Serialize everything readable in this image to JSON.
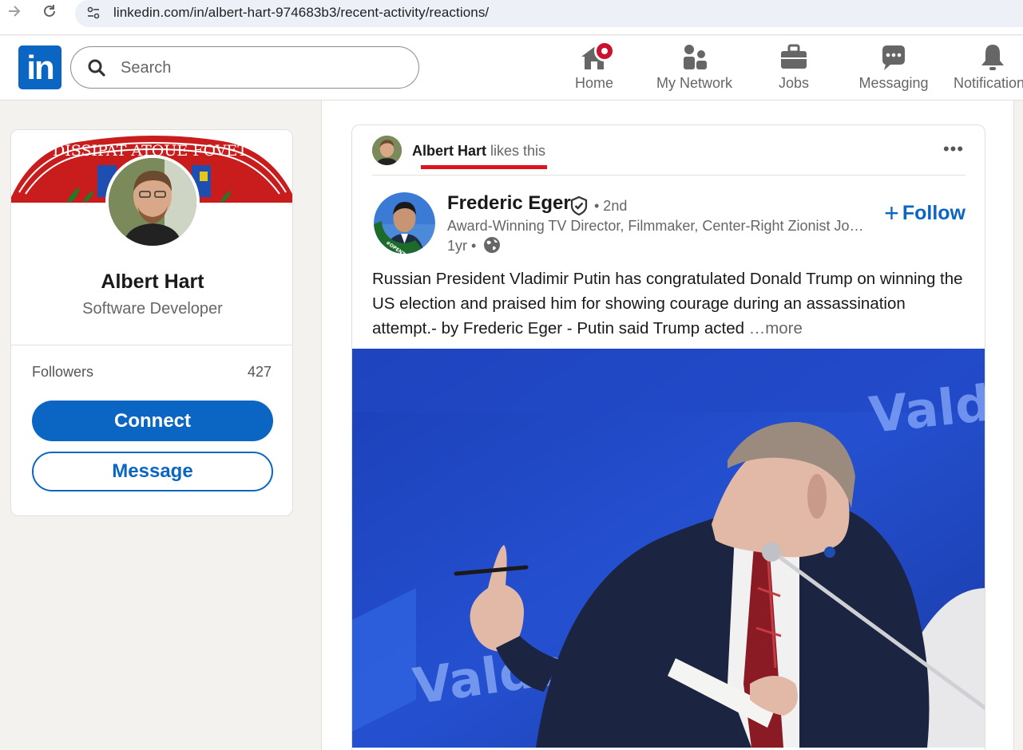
{
  "browser": {
    "url": "linkedin.com/in/albert-hart-974683b3/recent-activity/reactions/",
    "back_icon": "arrow-right-icon",
    "reload_icon": "reload-icon"
  },
  "header": {
    "logo_text": "in",
    "search_placeholder": "Search",
    "nav": [
      {
        "label": "Home",
        "icon": "home-icon",
        "badge": true
      },
      {
        "label": "My Network",
        "icon": "network-icon"
      },
      {
        "label": "Jobs",
        "icon": "briefcase-icon"
      },
      {
        "label": "Messaging",
        "icon": "chat-icon"
      },
      {
        "label": "Notifications",
        "icon": "bell-icon"
      }
    ]
  },
  "profile": {
    "banner_motto": "DISSIPAT ATQUE FOVET",
    "name": "Albert Hart",
    "title": "Software Developer",
    "followers_label": "Followers",
    "followers_count": "427",
    "connect_label": "Connect",
    "message_label": "Message"
  },
  "post": {
    "activity_actor": "Albert Hart",
    "activity_action": " likes this",
    "author_name": "Frederic Eger",
    "degree": "• 2nd",
    "headline": "Award-Winning TV Director, Filmmaker, Center-Right Zionist Journalist",
    "time": "1yr •",
    "follow_label": "Follow",
    "opentowork_text": "#OPENTOWORK",
    "text": "Russian President Vladimir Putin has congratulated Donald Trump on winning the US election and praised him for showing courage during an assassination attempt.- by Frederic Eger - Putin said Trump acted ",
    "see_more_label": "…more",
    "image_backdrop_text": "Valdai"
  },
  "colors": {
    "brand_blue": "#0a66c2",
    "badge_red": "#cb112d",
    "underline_red": "#e0121f"
  }
}
